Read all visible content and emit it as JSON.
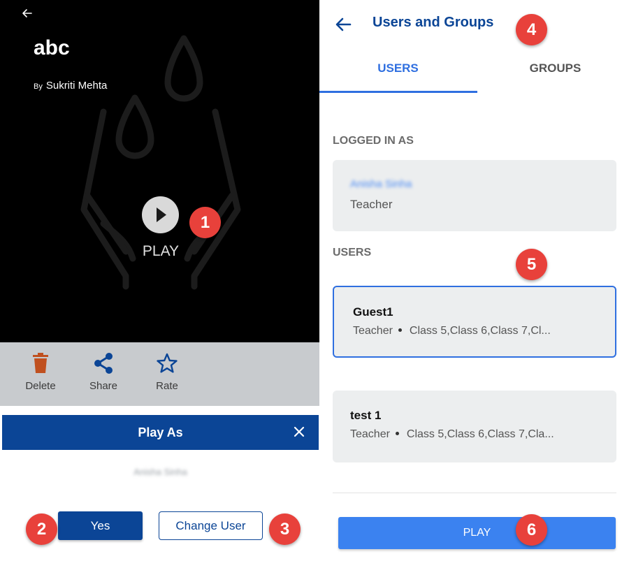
{
  "left": {
    "content_title": "abc",
    "author_prefix": "By",
    "author_name": "Sukriti Mehta",
    "play_label": "PLAY",
    "actions": [
      {
        "label": "Delete",
        "icon": "trash-icon"
      },
      {
        "label": "Share",
        "icon": "share-icon"
      },
      {
        "label": "Rate",
        "icon": "star-icon"
      }
    ],
    "dialog": {
      "title": "Play As",
      "user_name_blurred": "Anisha Sinha",
      "yes_label": "Yes",
      "change_user_label": "Change User"
    }
  },
  "right": {
    "title": "Users and Groups",
    "tabs": [
      {
        "label": "USERS",
        "active": true
      },
      {
        "label": "GROUPS",
        "active": false
      }
    ],
    "logged_in_label": "LOGGED IN AS",
    "logged_in_user": {
      "name_blurred": "Anisha Sinha",
      "role": "Teacher"
    },
    "users_label": "USERS",
    "users": [
      {
        "name": "Guest1",
        "role": "Teacher",
        "classes": "Class 5,Class 6,Class 7,Cl...",
        "selected": true
      },
      {
        "name": "test 1",
        "role": "Teacher",
        "classes": "Class 5,Class 6,Class 7,Cla...",
        "selected": false
      }
    ],
    "play_button_label": "PLAY"
  },
  "badges": [
    "1",
    "2",
    "3",
    "4",
    "5",
    "6"
  ],
  "colors": {
    "primary_dark": "#0b4596",
    "primary": "#3b82f0",
    "badge": "#e8413b",
    "card_bg": "#eceeef",
    "delete_icon": "#c0501f"
  }
}
